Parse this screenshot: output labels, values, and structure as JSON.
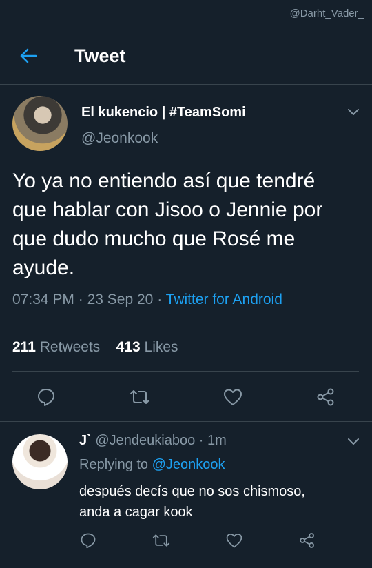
{
  "watermark": "@Darht_Vader_",
  "header": {
    "title": "Tweet"
  },
  "tweet": {
    "author_name": "El kukencio | #TeamSomi",
    "author_handle": "@Jeonkook",
    "text": "Yo ya no entiendo así que tendré\nque hablar con Jisoo o Jennie por\nque dudo mucho que Rosé me\nayude.",
    "time": "07:34 PM",
    "date": "23 Sep 20",
    "sep": "·",
    "source": "Twitter for Android",
    "retweets_count": "211",
    "retweets_label": "Retweets",
    "likes_count": "413",
    "likes_label": "Likes"
  },
  "reply": {
    "author_name": "J`",
    "author_handle": "@Jendeukiaboo",
    "age": "1m",
    "replying_prefix": "Replying to",
    "replying_to": "@Jeonkook",
    "text": "después decís que no sos chismoso,\nanda a cagar kook"
  },
  "colors": {
    "background": "#15202b",
    "accent": "#1da1f2",
    "secondary_text": "#8899a6",
    "divider": "#38444d"
  },
  "icons": [
    "back-arrow-icon",
    "chevron-down-icon",
    "reply-icon",
    "retweet-icon",
    "like-icon",
    "share-icon"
  ]
}
